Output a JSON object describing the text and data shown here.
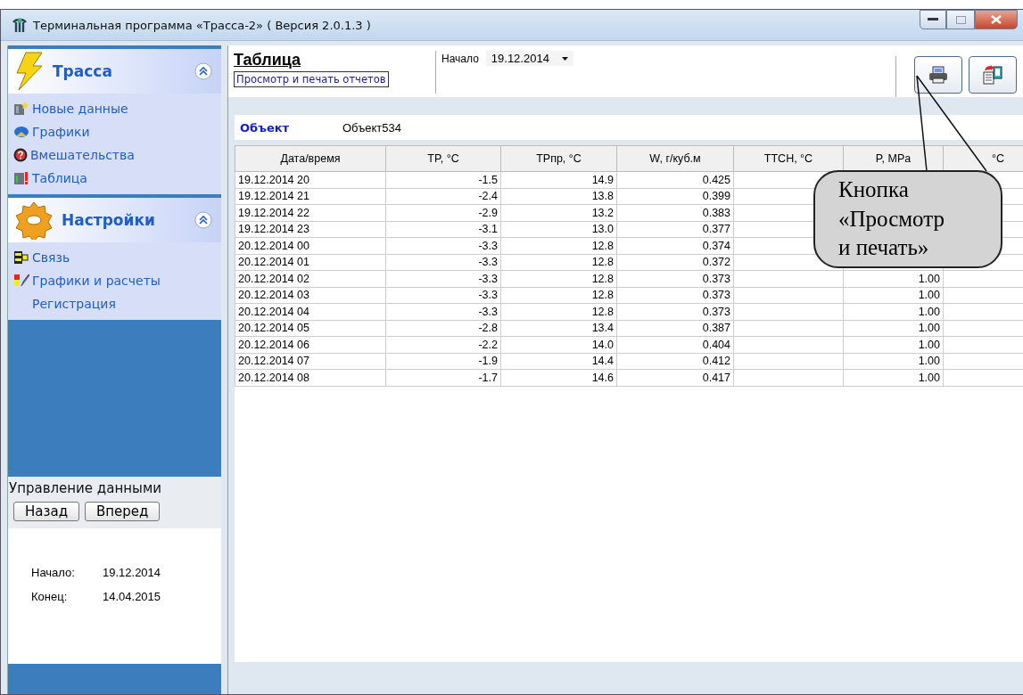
{
  "window": {
    "title": "Терминальная программа «Трасса-2» ( Версия 2.0.1.3 )"
  },
  "sidebar": {
    "groups": [
      {
        "title": "Трасса",
        "expanded": true,
        "items": [
          {
            "label": "Новые данные"
          },
          {
            "label": "Графики"
          },
          {
            "label": "Вмешательства"
          },
          {
            "label": "Таблица"
          }
        ]
      },
      {
        "title": "Настройки",
        "expanded": true,
        "items": [
          {
            "label": "Связь"
          },
          {
            "label": "Графики и расчеты"
          },
          {
            "label": "Регистрация"
          }
        ]
      }
    ],
    "data_control": {
      "title": "Управление данными",
      "buttons": [
        "Назад",
        "Вперед"
      ],
      "fields": [
        {
          "label": "Начало:",
          "value": "19.12.2014"
        },
        {
          "label": "Конец:",
          "value": "14.04.2015"
        }
      ]
    }
  },
  "header": {
    "title": "Таблица",
    "subtitle": "Просмотр и печать отчетов",
    "start_label": "Начало",
    "start_value": "19.12.2014"
  },
  "object": {
    "label": "Объект",
    "value": "Объект534"
  },
  "table": {
    "columns": [
      "Дата/время",
      "TP, °C",
      "TPпр, °C",
      "W, г/куб.м",
      "TTCH, °C",
      "P, MPa",
      "°C"
    ],
    "rows": [
      {
        "date": "19.12.2014 20",
        "tp": "-1.5",
        "tppr": "14.9",
        "w": "0.425"
      },
      {
        "date": "19.12.2014 21",
        "tp": "-2.4",
        "tppr": "13.8",
        "w": "0.399"
      },
      {
        "date": "19.12.2014 22",
        "tp": "-2.9",
        "tppr": "13.2",
        "w": "0.383"
      },
      {
        "date": "19.12.2014 23",
        "tp": "-3.1",
        "tppr": "13.0",
        "w": "0.377"
      },
      {
        "date": "20.12.2014 00",
        "tp": "-3.3",
        "tppr": "12.8",
        "w": "0.374"
      },
      {
        "date": "20.12.2014 01",
        "tp": "-3.3",
        "tppr": "12.8",
        "w": "0.372"
      },
      {
        "date": "20.12.2014 02",
        "tp": "-3.3",
        "tppr": "12.8",
        "w": "0.373",
        "p": "1.00"
      },
      {
        "date": "20.12.2014 03",
        "tp": "-3.3",
        "tppr": "12.8",
        "w": "0.373",
        "p": "1.00"
      },
      {
        "date": "20.12.2014 04",
        "tp": "-3.3",
        "tppr": "12.8",
        "w": "0.373",
        "p": "1.00"
      },
      {
        "date": "20.12.2014 05",
        "tp": "-2.8",
        "tppr": "13.4",
        "w": "0.387",
        "p": "1.00"
      },
      {
        "date": "20.12.2014 06",
        "tp": "-2.2",
        "tppr": "14.0",
        "w": "0.404",
        "p": "1.00"
      },
      {
        "date": "20.12.2014 07",
        "tp": "-1.9",
        "tppr": "14.4",
        "w": "0.412",
        "p": "1.00"
      },
      {
        "date": "20.12.2014 08",
        "tp": "-1.7",
        "tppr": "14.6",
        "w": "0.417",
        "p": "1.00"
      }
    ]
  },
  "callout": {
    "text": "Кнопка «Просмотр и печать»"
  }
}
